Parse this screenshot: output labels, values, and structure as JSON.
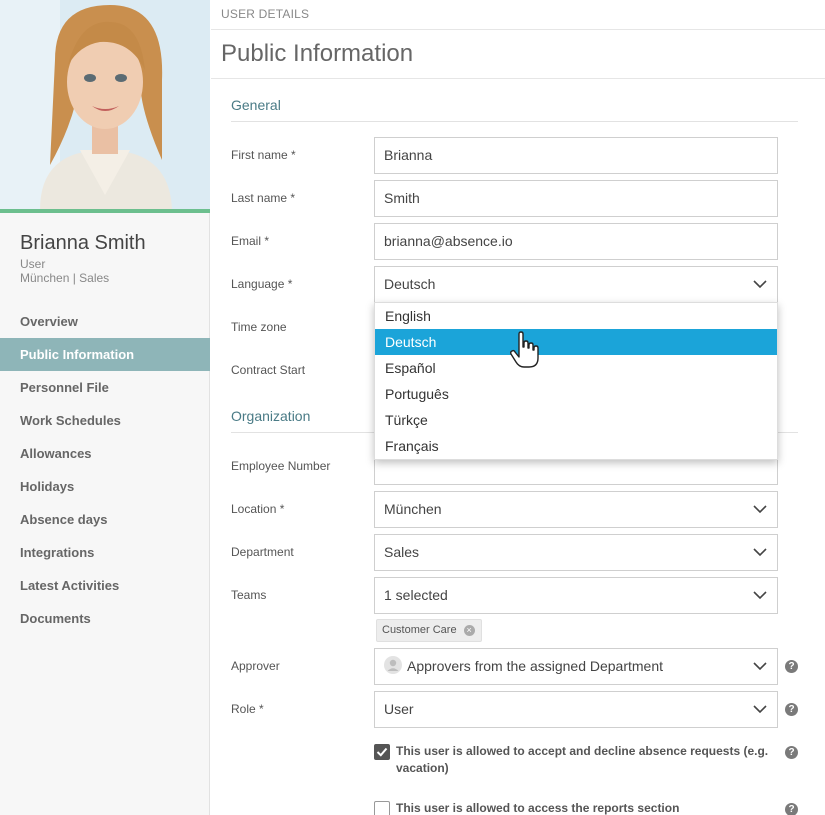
{
  "profile": {
    "name": "Brianna Smith",
    "role": "User",
    "location_department": "München | Sales"
  },
  "nav": {
    "items": [
      {
        "label": "Overview"
      },
      {
        "label": "Public Information",
        "active": true
      },
      {
        "label": "Personnel File"
      },
      {
        "label": "Work Schedules"
      },
      {
        "label": "Allowances"
      },
      {
        "label": "Holidays"
      },
      {
        "label": "Absence days"
      },
      {
        "label": "Integrations"
      },
      {
        "label": "Latest Activities"
      },
      {
        "label": "Documents"
      }
    ]
  },
  "header": {
    "breadcrumb": "USER DETAILS",
    "title": "Public Information"
  },
  "general": {
    "section_title": "General",
    "first_name_label": "First name *",
    "first_name_value": "Brianna",
    "last_name_label": "Last name *",
    "last_name_value": "Smith",
    "email_label": "Email *",
    "email_value": "brianna@absence.io",
    "language_label": "Language *",
    "language_value": "Deutsch",
    "timezone_label": "Time zone",
    "contract_start_label": "Contract Start"
  },
  "language_dropdown": {
    "options": [
      "English",
      "Deutsch",
      "Español",
      "Português",
      "Türkçe",
      "Français"
    ],
    "highlighted": "Deutsch"
  },
  "organization": {
    "section_title": "Organization",
    "employee_number_label": "Employee Number",
    "location_label": "Location *",
    "location_value": "München",
    "department_label": "Department",
    "department_value": "Sales",
    "teams_label": "Teams",
    "teams_value": "1 selected",
    "team_chip": "Customer Care",
    "approver_label": "Approver",
    "approver_value": "Approvers from the assigned Department",
    "role_label": "Role *",
    "role_value": "User"
  },
  "permissions": {
    "absence_requests_label": "This user is allowed to accept and decline absence requests (e.g. vacation)",
    "absence_requests_checked": true,
    "reports_label": "This user is allowed to access the reports section",
    "reports_checked": false
  },
  "colors": {
    "accent": "#8eb5b8",
    "section_title": "#4a7b86",
    "dropdown_highlight": "#1ba4d9",
    "photo_bar": "#6cbf8e"
  }
}
